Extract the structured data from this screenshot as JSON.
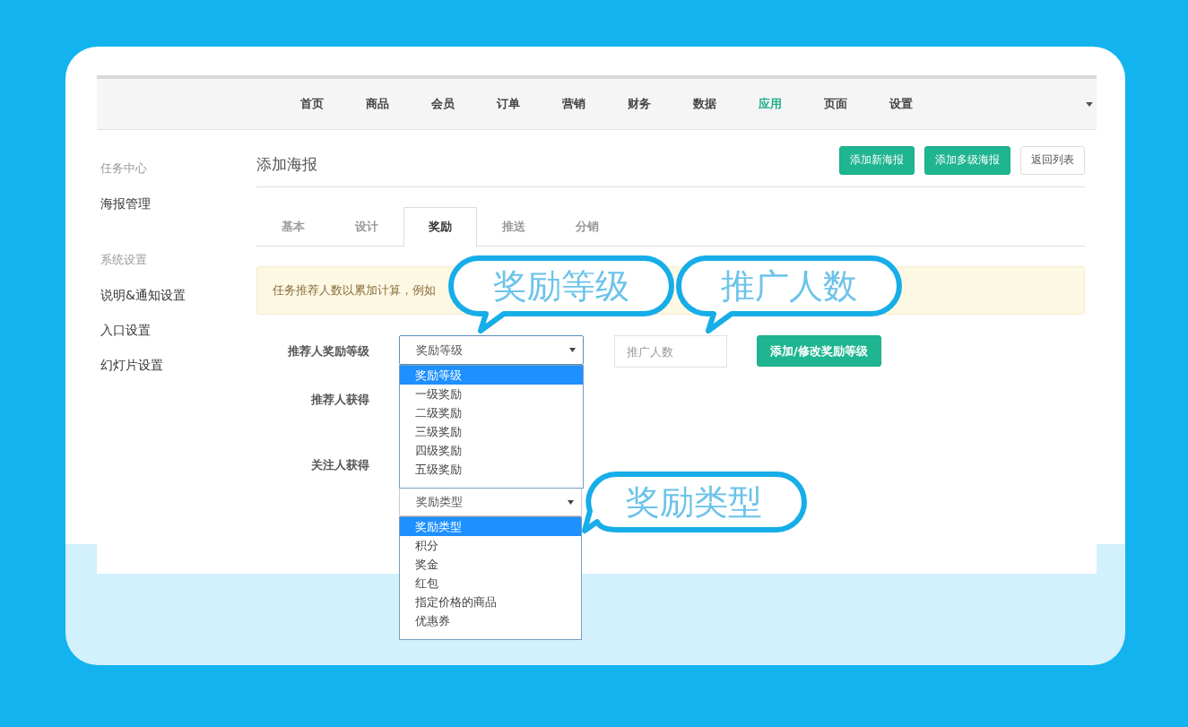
{
  "nav": {
    "items": [
      {
        "label": "首页",
        "selected": false
      },
      {
        "label": "商品",
        "selected": false
      },
      {
        "label": "会员",
        "selected": false
      },
      {
        "label": "订单",
        "selected": false
      },
      {
        "label": "营销",
        "selected": false
      },
      {
        "label": "财务",
        "selected": false
      },
      {
        "label": "数据",
        "selected": false
      },
      {
        "label": "应用",
        "selected": true
      },
      {
        "label": "页面",
        "selected": false
      },
      {
        "label": "设置",
        "selected": false
      }
    ]
  },
  "sidebar": {
    "groups": [
      {
        "heading": "任务中心",
        "items": [
          "海报管理"
        ]
      },
      {
        "heading": "系统设置",
        "items": [
          "说明&通知设置",
          "入口设置",
          "幻灯片设置"
        ]
      }
    ]
  },
  "page": {
    "title": "添加海报",
    "buttons": [
      {
        "label": "添加新海报",
        "kind": "primary"
      },
      {
        "label": "添加多级海报",
        "kind": "primary"
      },
      {
        "label": "返回列表",
        "kind": "default"
      }
    ]
  },
  "tabs": [
    {
      "label": "基本",
      "selected": false
    },
    {
      "label": "设计",
      "selected": false
    },
    {
      "label": "奖励",
      "selected": true
    },
    {
      "label": "推送",
      "selected": false
    },
    {
      "label": "分销",
      "selected": false
    }
  ],
  "alert": {
    "text": "任务推荐人数以累加计算，例如"
  },
  "form": {
    "level_label": "推荐人奖励等级",
    "level_select": {
      "value": "奖励等级",
      "expanded": true,
      "options": [
        {
          "label": "奖励等级",
          "selected": true
        },
        {
          "label": "一级奖励",
          "selected": false
        },
        {
          "label": "二级奖励",
          "selected": false
        },
        {
          "label": "三级奖励",
          "selected": false
        },
        {
          "label": "四级奖励",
          "selected": false
        },
        {
          "label": "五级奖励",
          "selected": false
        }
      ]
    },
    "count_field": {
      "placeholder": "推广人数"
    },
    "submit_button": "添加/修改奖励等级",
    "referrer_label": "推荐人获得",
    "follower_label": "关注人获得",
    "type_select": {
      "value": "奖励类型",
      "expanded": true,
      "options": [
        {
          "label": "奖励类型",
          "selected": true
        },
        {
          "label": "积分",
          "selected": false
        },
        {
          "label": "奖金",
          "selected": false
        },
        {
          "label": "红包",
          "selected": false
        },
        {
          "label": "指定价格的商品",
          "selected": false
        },
        {
          "label": "优惠券",
          "selected": false
        }
      ]
    }
  },
  "callouts": [
    {
      "text": "奖励等级",
      "kind": "tail-down"
    },
    {
      "text": "推广人数",
      "kind": "tail-down"
    },
    {
      "text": "奖励类型",
      "kind": "tail-left"
    }
  ]
}
